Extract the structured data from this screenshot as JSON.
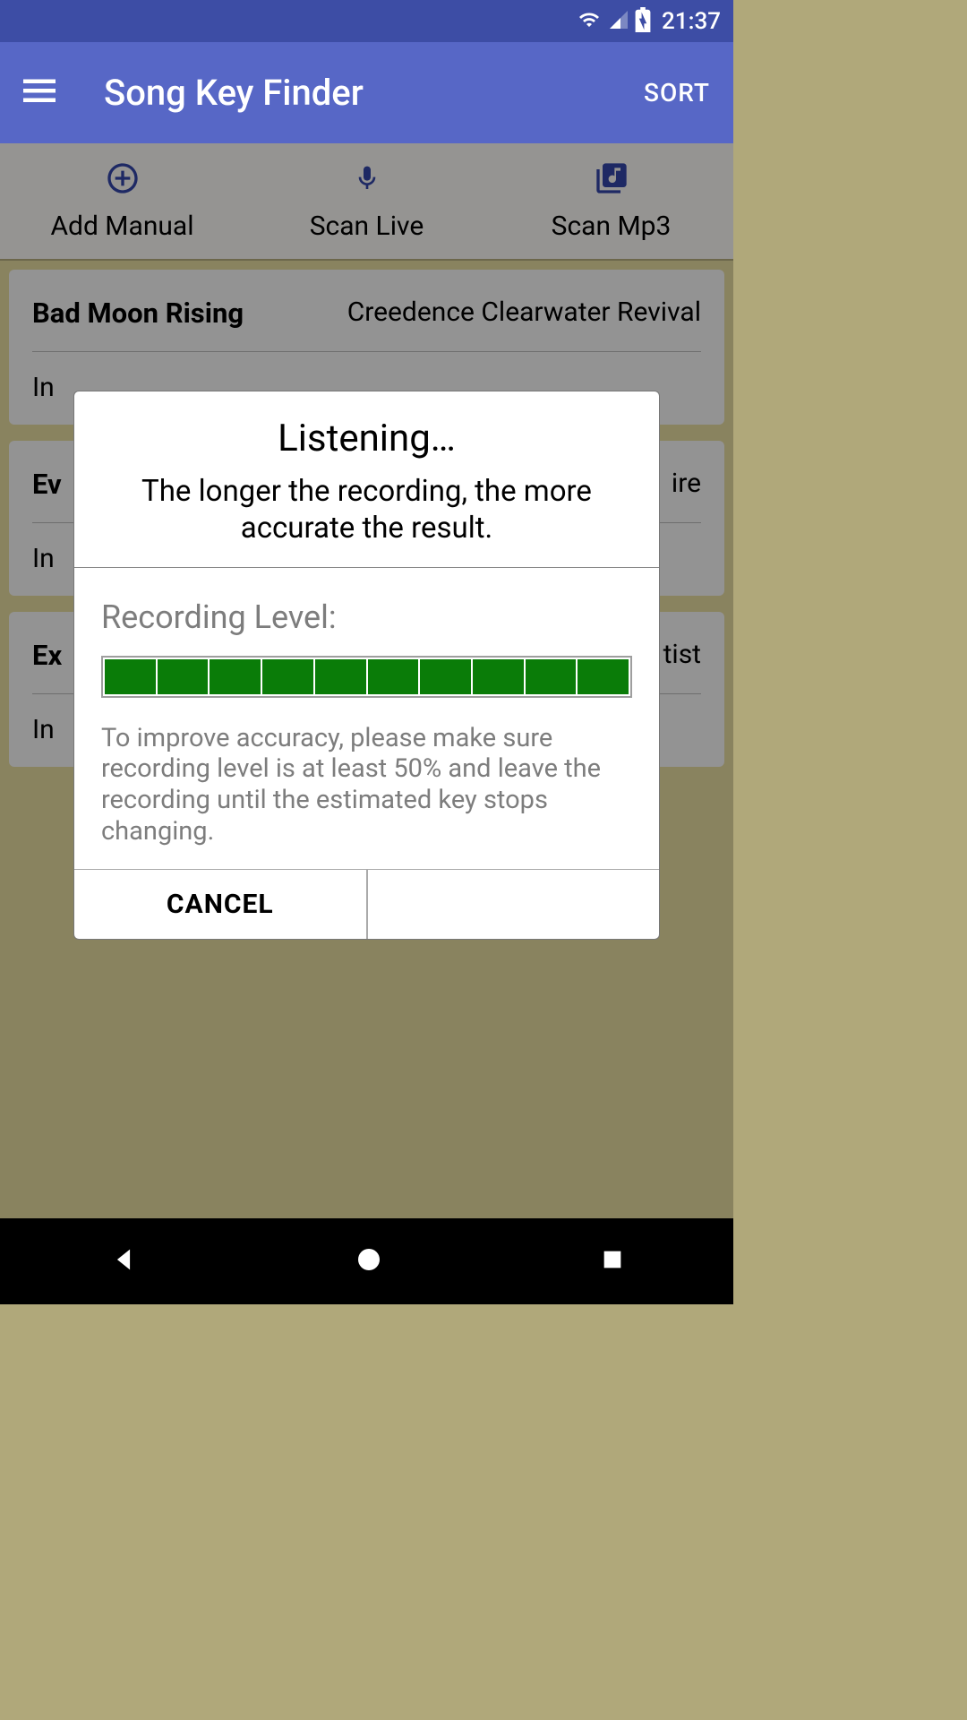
{
  "status": {
    "time": "21:37"
  },
  "header": {
    "title": "Song Key Finder",
    "sort": "SORT"
  },
  "actions": {
    "add": "Add Manual",
    "live": "Scan Live",
    "mp3": "Scan Mp3"
  },
  "songs": [
    {
      "title": "Bad Moon Rising",
      "artist": "Creedence Clearwater Revival",
      "key": "In"
    },
    {
      "title": "Ev",
      "artist": "ire",
      "key": "In"
    },
    {
      "title": "Ex",
      "artist": "tist",
      "key": "In"
    }
  ],
  "dialog": {
    "title": "Listening…",
    "subtitle": "The longer the recording, the more accurate the result.",
    "rec_label": "Recording Level:",
    "level_segments": 10,
    "help": "To improve accuracy, please make sure recording level is at least 50% and leave the recording until the estimated key stops changing.",
    "cancel": "CANCEL"
  }
}
